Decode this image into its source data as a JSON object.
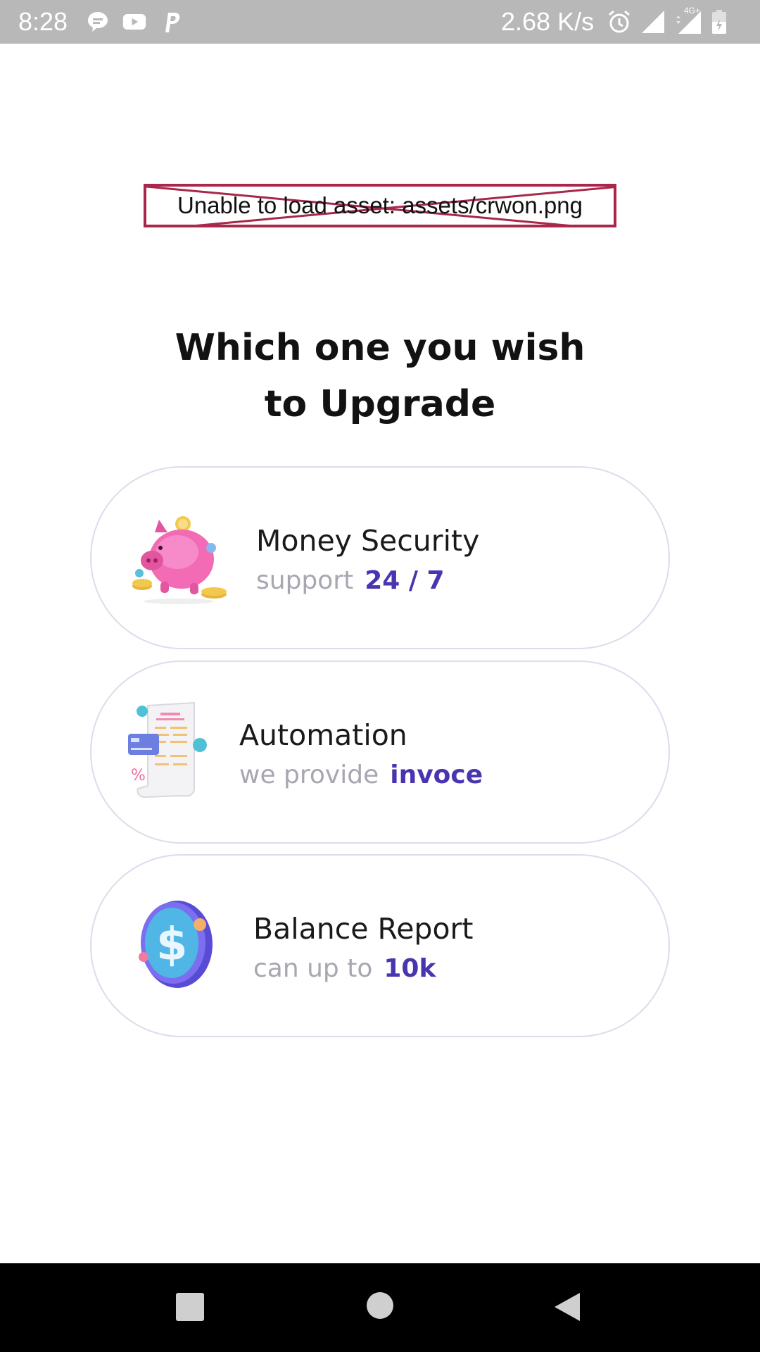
{
  "status_bar": {
    "time": "8:28",
    "speed": "2.68 K/s",
    "icons_left": [
      "chat-icon",
      "youtube-icon",
      "paypal-icon"
    ],
    "icons_right": [
      "alarm-icon",
      "signal-icon",
      "4g-signal-icon",
      "battery-icon"
    ],
    "network_label": "4G+"
  },
  "asset_error": {
    "text": "Unable to load asset: assets/crwon.png"
  },
  "heading": {
    "line1": "Which one you wish",
    "line2": "to Upgrade"
  },
  "options": [
    {
      "title": "Money Security",
      "sub_text": "support",
      "sub_accent": "24 / 7",
      "icon": "piggy-bank-icon"
    },
    {
      "title": "Automation",
      "sub_text": "we provide",
      "sub_accent": "invoce",
      "icon": "invoice-icon"
    },
    {
      "title": "Balance Report",
      "sub_text": "can up to",
      "sub_accent": "10k",
      "icon": "dollar-coin-icon"
    }
  ],
  "nav_bar": {
    "buttons": [
      "recents-button",
      "home-button",
      "back-button"
    ]
  },
  "colors": {
    "accent": "#4a34b0",
    "muted": "#a7a7b2",
    "error_border": "#a8274a",
    "status_bar": "#b8b8b8"
  }
}
